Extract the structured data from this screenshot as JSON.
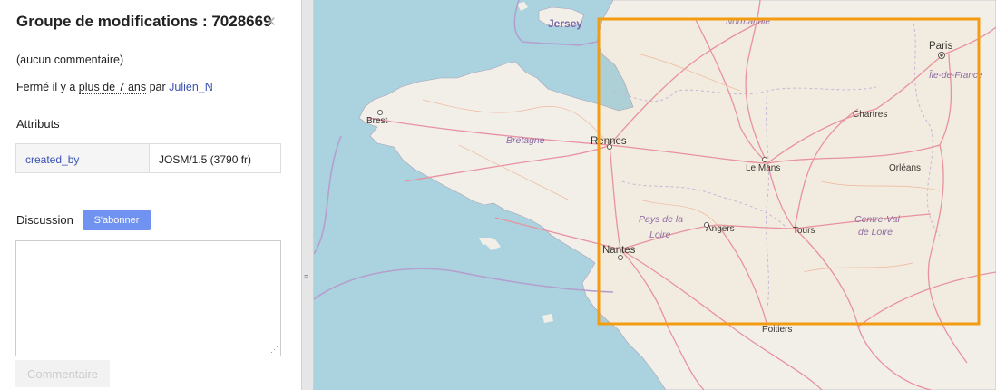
{
  "sidebar": {
    "title": "Groupe de modifications : 7028669",
    "close_icon": "×",
    "comment": "(aucun commentaire)",
    "closed_prefix": "Fermé il y a ",
    "closed_time": "plus de 7 ans",
    "closed_by_word": " par ",
    "user": "Julien_N",
    "attributes_heading": "Attributs",
    "attributes": [
      {
        "key": "created_by",
        "value": "JOSM/1.5 (3790 fr)"
      }
    ],
    "discussion_heading": "Discussion",
    "subscribe_label": "S'abonner",
    "comment_placeholder": "",
    "comment_button_label": "Commentaire"
  },
  "map": {
    "bbox_color": "#f39c12",
    "land_color": "#f2efe9",
    "water_color": "#aad3df",
    "road_color": "#e892a2",
    "labels": {
      "jersey": "Jersey",
      "normandie": "Normandie",
      "paris": "Paris",
      "ile_de_france": "Île-de-France",
      "brest": "Brest",
      "bretagne": "Bretagne",
      "rennes": "Rennes",
      "chartres": "Chartres",
      "le_mans": "Le Mans",
      "orleans": "Orléans",
      "pays_de_la_loire_1": "Pays de la",
      "pays_de_la_loire_2": "Loire",
      "angers": "Angers",
      "tours": "Tours",
      "centre_val_1": "Centre-Val",
      "centre_val_2": "de Loire",
      "nantes": "Nantes",
      "poitiers": "Poitiers"
    }
  }
}
